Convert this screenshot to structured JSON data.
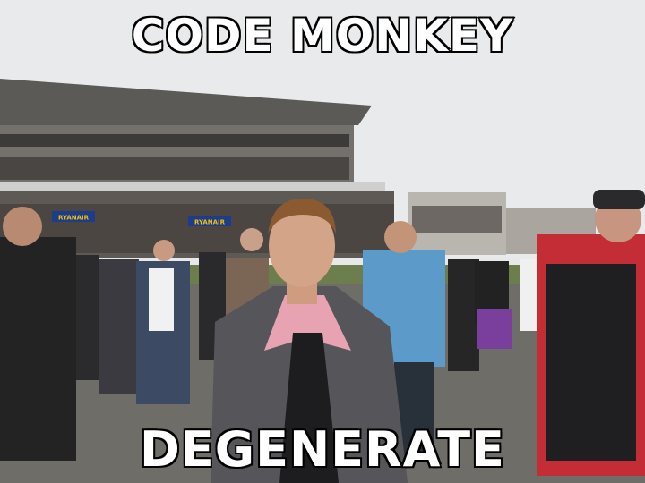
{
  "meme": {
    "top_text": "CODE MONKEY",
    "bottom_text": "DEGENERATE",
    "text_color": "#ffffff",
    "outline_color": "#000000"
  },
  "scene": {
    "sky_color": "#e9eaec",
    "grandstand_color": "#8a8580",
    "ground_color": "#6f6d68",
    "jacket_color": "#55555a",
    "shirt_color": "#e7a3b2"
  },
  "signage": {
    "banner_left": "RYANAIR",
    "banner_right": "RYANAIR"
  }
}
